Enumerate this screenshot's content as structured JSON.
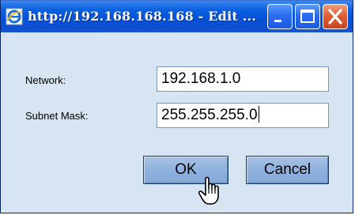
{
  "window": {
    "title": "http://192.168.168.168 - Edit ..."
  },
  "form": {
    "network_label": "Network:",
    "network_value": "192.168.1.0",
    "mask_label": "Subnet Mask:",
    "mask_value": "255.255.255.0"
  },
  "buttons": {
    "ok_label": "OK",
    "cancel_label": "Cancel"
  },
  "icons": {
    "app": "internet-explorer-icon",
    "minimize": "minimize-icon",
    "maximize": "maximize-icon",
    "close": "close-icon",
    "pointer": "hand-pointer-icon"
  },
  "colors": {
    "titlebar": "#0a5fe0",
    "dialog_background": "#d7e4f1",
    "button_face": "#8fb2de",
    "close_button": "#e0603a"
  }
}
